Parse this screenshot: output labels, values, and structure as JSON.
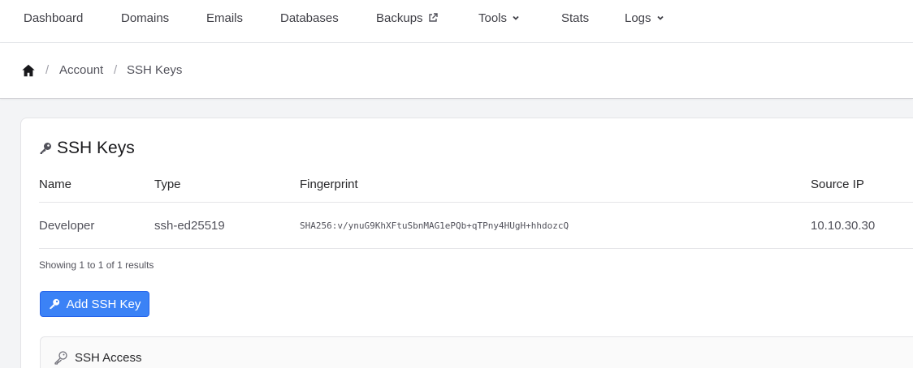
{
  "nav": {
    "items": [
      {
        "label": "Dashboard"
      },
      {
        "label": "Domains"
      },
      {
        "label": "Emails"
      },
      {
        "label": "Databases"
      },
      {
        "label": "Backups",
        "icon": "external-link-icon"
      },
      {
        "label": "Tools",
        "icon": "chevron-down-icon"
      },
      {
        "label": "Stats"
      },
      {
        "label": "Logs",
        "icon": "chevron-down-icon"
      }
    ]
  },
  "breadcrumb": {
    "home_icon": "home-icon",
    "items": [
      "Account",
      "SSH Keys"
    ],
    "separator": "/"
  },
  "card": {
    "title": "SSH Keys",
    "title_icon": "key-icon",
    "table": {
      "headers": [
        "Name",
        "Type",
        "Fingerprint",
        "Source IP"
      ],
      "rows": [
        {
          "name": "Developer",
          "type": "ssh-ed25519",
          "fingerprint": "SHA256:v/ynuG9KhXFtuSbnMAG1ePQb+qTPny4HUgH+hhdozcQ",
          "source_ip": "10.10.30.30"
        }
      ]
    },
    "results_text": "Showing 1 to 1 of 1 results",
    "add_button_label": "Add SSH Key",
    "access_section_title": "SSH Access"
  },
  "colors": {
    "primary": "#3b82f6",
    "background": "#f3f4f6",
    "text": "#3f3f46"
  }
}
